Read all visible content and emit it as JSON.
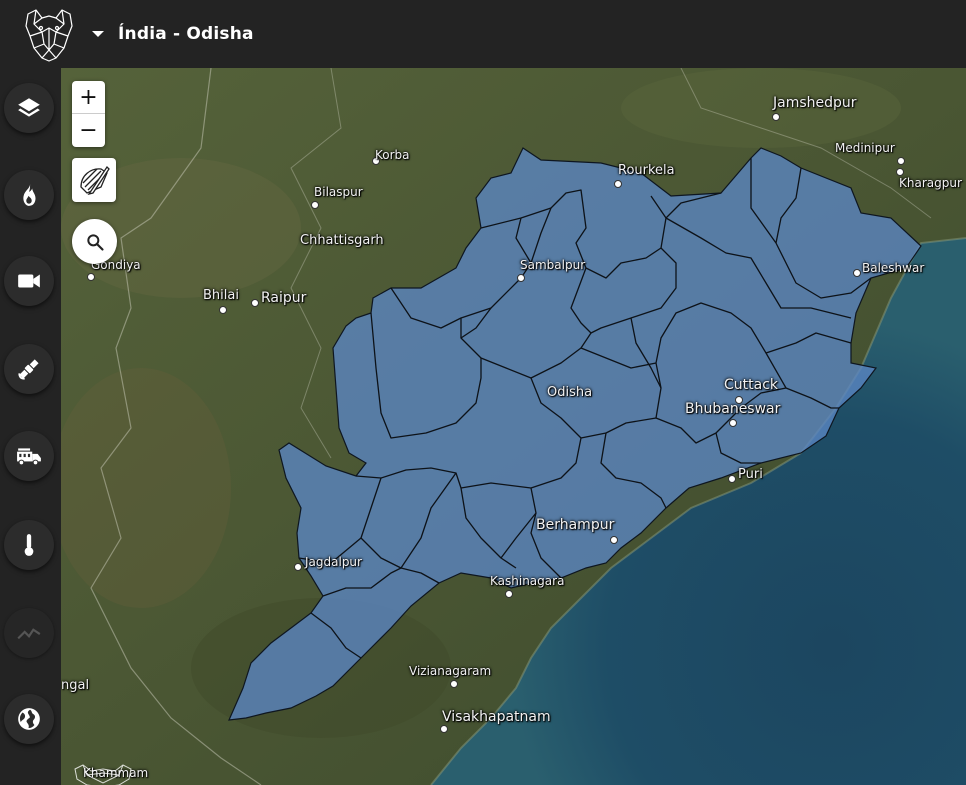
{
  "header": {
    "title": "Índia - Odisha",
    "logo_icon": "jaguar-logo-icon",
    "dropdown_icon": "caret-down-icon"
  },
  "sidebar": {
    "items": [
      {
        "name": "layers",
        "icon": "layers-icon"
      },
      {
        "name": "fire",
        "icon": "fire-icon"
      },
      {
        "name": "camera",
        "icon": "video-camera-icon"
      },
      {
        "name": "satellite",
        "icon": "satellite-icon"
      },
      {
        "name": "fire-truck",
        "icon": "fire-truck-icon"
      },
      {
        "name": "temperature",
        "icon": "thermometer-icon"
      },
      {
        "name": "chart",
        "icon": "line-chart-icon",
        "state": "disabled"
      },
      {
        "name": "globe",
        "icon": "globe-icon"
      }
    ]
  },
  "map_controls": {
    "zoom_in_label": "+",
    "zoom_out_label": "−",
    "draw_icon": "draw-polygon-icon",
    "search_icon": "search-icon"
  },
  "map": {
    "selected_region": "Odisha",
    "region_fill": "#5b87c4",
    "ocean_color": "#1d4a63",
    "land_color": "#4c5a35",
    "place_labels": [
      {
        "id": "jamshedpur",
        "text": "Jamshedpur"
      },
      {
        "id": "korba",
        "text": "Korba"
      },
      {
        "id": "rourkela",
        "text": "Rourkela"
      },
      {
        "id": "medinipur",
        "text": "Medinipur"
      },
      {
        "id": "kharagpur",
        "text": "Kharagpur"
      },
      {
        "id": "bilaspur",
        "text": "Bilaspur"
      },
      {
        "id": "chhattisgarh",
        "text": "Chhattisgarh"
      },
      {
        "id": "gondiya",
        "text": "Gondiya"
      },
      {
        "id": "sambalpur",
        "text": "Sambalpur"
      },
      {
        "id": "baleshwar",
        "text": "Baleshwar"
      },
      {
        "id": "bhilai",
        "text": "Bhilai"
      },
      {
        "id": "raipur",
        "text": "Raipur"
      },
      {
        "id": "cuttack",
        "text": "Cuttack"
      },
      {
        "id": "odisha",
        "text": "Odisha"
      },
      {
        "id": "bhubaneswar",
        "text": "Bhubaneswar"
      },
      {
        "id": "puri",
        "text": "Puri"
      },
      {
        "id": "berhampur",
        "text": "Berhampur"
      },
      {
        "id": "jagdalpur",
        "text": "Jagdalpur"
      },
      {
        "id": "kashinagara",
        "text": "Kashinagara"
      },
      {
        "id": "vizianagaram",
        "text": "Vizianagaram"
      },
      {
        "id": "visakhapatnam",
        "text": "Visakhapatnam"
      },
      {
        "id": "ngal",
        "text": "ngal"
      },
      {
        "id": "khammam",
        "text": "Khammam"
      }
    ]
  }
}
